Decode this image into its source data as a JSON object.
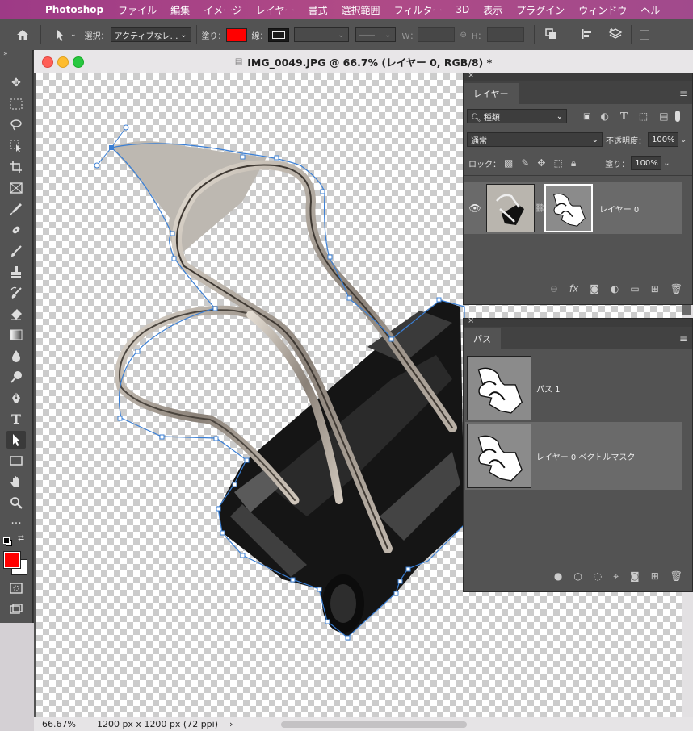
{
  "menubar": {
    "app": "Photoshop",
    "items": [
      "ファイル",
      "編集",
      "イメージ",
      "レイヤー",
      "書式",
      "選択範囲",
      "フィルター",
      "3D",
      "表示",
      "プラグイン",
      "ウィンドウ",
      "ヘル"
    ]
  },
  "options": {
    "select_label": "選択：",
    "select_value": "アクティブなレ…",
    "fill_label": "塗り：",
    "fill_color": "#ff0000",
    "stroke_label": "線：",
    "w_label": "W：",
    "h_label": "H："
  },
  "document": {
    "title": "IMG_0049.JPG @ 66.7% (レイヤー 0, RGB/8) *",
    "zoom": "66.67%",
    "info": "1200 px x 1200 px (72 ppi)"
  },
  "layers_panel": {
    "tab": "レイヤー",
    "filter_kind": "種類",
    "blend_mode": "通常",
    "opacity_label": "不透明度：",
    "opacity": "100%",
    "lock_label": "ロック：",
    "fill_label": "塗り：",
    "fill": "100%",
    "layers": [
      {
        "name": "レイヤー 0"
      }
    ]
  },
  "paths_panel": {
    "tab": "パス",
    "paths": [
      {
        "name": "パス 1",
        "selected": false
      },
      {
        "name": "レイヤー 0 ベクトルマスク",
        "selected": true
      }
    ]
  },
  "colors": {
    "foreground": "#ff0000",
    "background": "#ffffff",
    "path_stroke": "#3a7fd5"
  }
}
